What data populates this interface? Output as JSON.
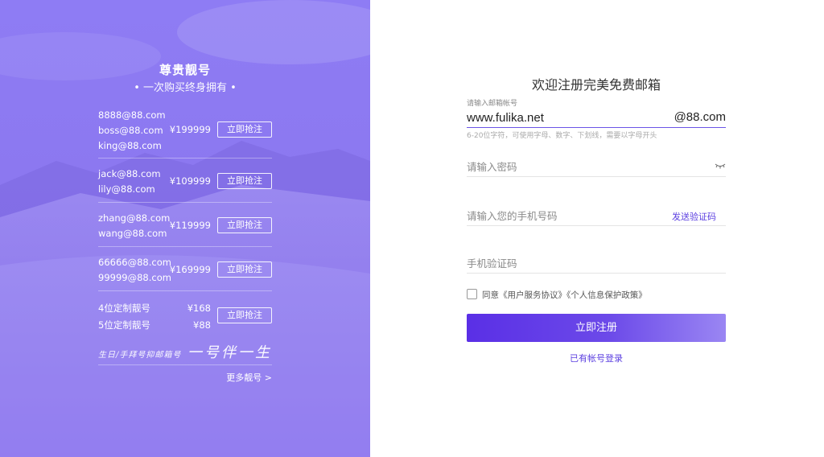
{
  "promo": {
    "title": "尊贵靓号",
    "subtitle": "• 一次购买终身拥有 •",
    "rows": [
      {
        "names": [
          "8888@88.com",
          "boss@88.com",
          "king@88.com"
        ],
        "price": "¥199999",
        "button": "立即抢注"
      },
      {
        "names": [
          "jack@88.com",
          "lily@88.com"
        ],
        "price": "¥109999",
        "button": "立即抢注"
      },
      {
        "names": [
          "zhang@88.com",
          "wang@88.com"
        ],
        "price": "¥119999",
        "button": "立即抢注"
      },
      {
        "names": [
          "66666@88.com",
          "99999@88.com"
        ],
        "price": "¥169999",
        "button": "立即抢注"
      }
    ],
    "custom": {
      "names": [
        "4位定制靓号",
        "5位定制靓号"
      ],
      "prices": [
        "¥168",
        "¥88"
      ],
      "button": "立即抢注"
    },
    "slogan_small": "生日/手拜号抑邮箱号",
    "slogan_big": "一号伴一生",
    "more_link": "更多靓号 >"
  },
  "form": {
    "title": "欢迎注册完美免费邮箱",
    "account_label": "请输入邮箱帐号",
    "account_value": "www.fulika.net",
    "domain_suffix": "@88.com",
    "account_hint": "6-20位字符，可使用字母、数字、下划线，需要以字母开头",
    "password_placeholder": "请输入密码",
    "phone_placeholder": "请输入您的手机号码",
    "send_code": "发送验证码",
    "code_placeholder": "手机验证码",
    "agree_text": "同意《用户服务协议》《个人信息保护政策》",
    "submit": "立即注册",
    "login_link": "已有帐号登录"
  }
}
